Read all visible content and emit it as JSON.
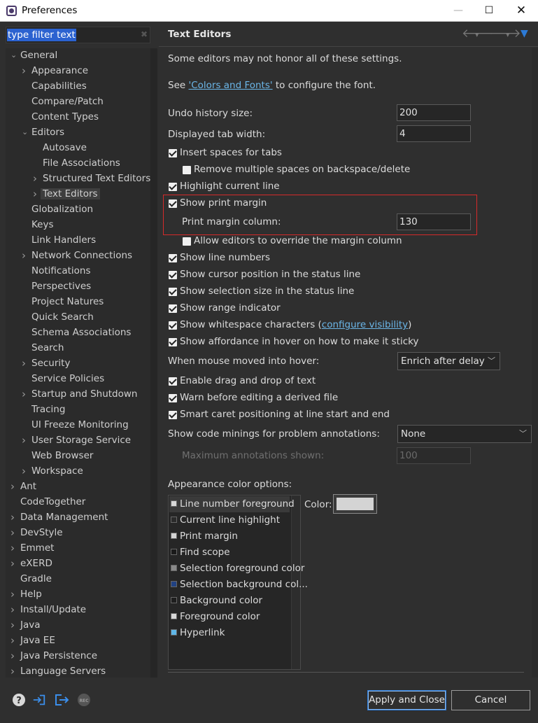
{
  "window": {
    "title": "Preferences"
  },
  "filter": {
    "value": "type filter text"
  },
  "tree": [
    {
      "label": "General",
      "level": 0,
      "expanded": true
    },
    {
      "label": "Appearance",
      "level": 1,
      "collapsed": true
    },
    {
      "label": "Capabilities",
      "level": 1
    },
    {
      "label": "Compare/Patch",
      "level": 1
    },
    {
      "label": "Content Types",
      "level": 1
    },
    {
      "label": "Editors",
      "level": 1,
      "expanded": true
    },
    {
      "label": "Autosave",
      "level": 2
    },
    {
      "label": "File Associations",
      "level": 2
    },
    {
      "label": "Structured Text Editors",
      "level": 2,
      "collapsed": true
    },
    {
      "label": "Text Editors",
      "level": 2,
      "collapsed": true,
      "selected": true
    },
    {
      "label": "Globalization",
      "level": 1
    },
    {
      "label": "Keys",
      "level": 1
    },
    {
      "label": "Link Handlers",
      "level": 1
    },
    {
      "label": "Network Connections",
      "level": 1,
      "collapsed": true
    },
    {
      "label": "Notifications",
      "level": 1
    },
    {
      "label": "Perspectives",
      "level": 1
    },
    {
      "label": "Project Natures",
      "level": 1
    },
    {
      "label": "Quick Search",
      "level": 1
    },
    {
      "label": "Schema Associations",
      "level": 1
    },
    {
      "label": "Search",
      "level": 1
    },
    {
      "label": "Security",
      "level": 1,
      "collapsed": true
    },
    {
      "label": "Service Policies",
      "level": 1
    },
    {
      "label": "Startup and Shutdown",
      "level": 1,
      "collapsed": true
    },
    {
      "label": "Tracing",
      "level": 1
    },
    {
      "label": "UI Freeze Monitoring",
      "level": 1
    },
    {
      "label": "User Storage Service",
      "level": 1,
      "collapsed": true
    },
    {
      "label": "Web Browser",
      "level": 1
    },
    {
      "label": "Workspace",
      "level": 1,
      "collapsed": true
    },
    {
      "label": "Ant",
      "level": 0,
      "collapsed": true
    },
    {
      "label": "CodeTogether",
      "level": 0
    },
    {
      "label": "Data Management",
      "level": 0,
      "collapsed": true
    },
    {
      "label": "DevStyle",
      "level": 0,
      "collapsed": true
    },
    {
      "label": "Emmet",
      "level": 0,
      "collapsed": true
    },
    {
      "label": "eXERD",
      "level": 0,
      "collapsed": true
    },
    {
      "label": "Gradle",
      "level": 0
    },
    {
      "label": "Help",
      "level": 0,
      "collapsed": true
    },
    {
      "label": "Install/Update",
      "level": 0,
      "collapsed": true
    },
    {
      "label": "Java",
      "level": 0,
      "collapsed": true
    },
    {
      "label": "Java EE",
      "level": 0,
      "collapsed": true
    },
    {
      "label": "Java Persistence",
      "level": 0,
      "collapsed": true
    },
    {
      "label": "Language Servers",
      "level": 0,
      "collapsed": true
    }
  ],
  "page": {
    "title": "Text Editors",
    "intro": "Some editors may not honor all of these settings.",
    "see_prefix": "See ",
    "see_link": "'Colors and Fonts'",
    "see_suffix": " to configure the font.",
    "undo_label": "Undo history size:",
    "undo_value": "200",
    "tab_label": "Displayed tab width:",
    "tab_value": "4",
    "insert_spaces": "Insert spaces for tabs",
    "remove_spaces": "Remove multiple spaces on backspace/delete",
    "highlight_line": "Highlight current line",
    "show_print_margin": "Show print margin",
    "print_margin_col_label": "Print margin column:",
    "print_margin_col_value": "130",
    "allow_override": "Allow editors to override the margin column",
    "show_line_numbers": "Show line numbers",
    "show_cursor_pos": "Show cursor position in the status line",
    "show_selection_size": "Show selection size in the status line",
    "show_range": "Show range indicator",
    "show_whitespace_prefix": "Show whitespace characters (",
    "show_whitespace_link": "configure visibility",
    "show_whitespace_suffix": ")",
    "show_affordance": "Show affordance in hover on how to make it sticky",
    "hover_label": "When mouse moved into hover:",
    "hover_value": "Enrich after delay",
    "drag_drop": "Enable drag and drop of text",
    "warn_derived": "Warn before editing a derived file",
    "smart_caret": "Smart caret positioning at line start and end",
    "code_minings_label": "Show code minings for problem annotations:",
    "code_minings_value": "None",
    "max_annotations_label": "Maximum annotations shown:",
    "max_annotations_value": "100",
    "appearance_label": "Appearance color options:",
    "color_label": "Color:",
    "color_value": "#d4d4d4",
    "color_items": [
      {
        "label": "Line number foreground",
        "swatch": "#d8d8d8",
        "selected": true
      },
      {
        "label": "Current line highlight",
        "swatch": "#2a2a2a"
      },
      {
        "label": "Print margin",
        "swatch": "#d4d4d4"
      },
      {
        "label": "Find scope",
        "swatch": "#1a1a1a"
      },
      {
        "label": "Selection foreground color",
        "swatch": "#8a8a8a"
      },
      {
        "label": "Selection background col...",
        "swatch": "#214283"
      },
      {
        "label": "Background color",
        "swatch": "#1e1e1e"
      },
      {
        "label": "Foreground color",
        "swatch": "#d8d8d8"
      },
      {
        "label": "Hyperlink",
        "swatch": "#5fb7e8"
      }
    ]
  },
  "buttons": {
    "apply_close": "Apply and Close",
    "cancel": "Cancel"
  }
}
